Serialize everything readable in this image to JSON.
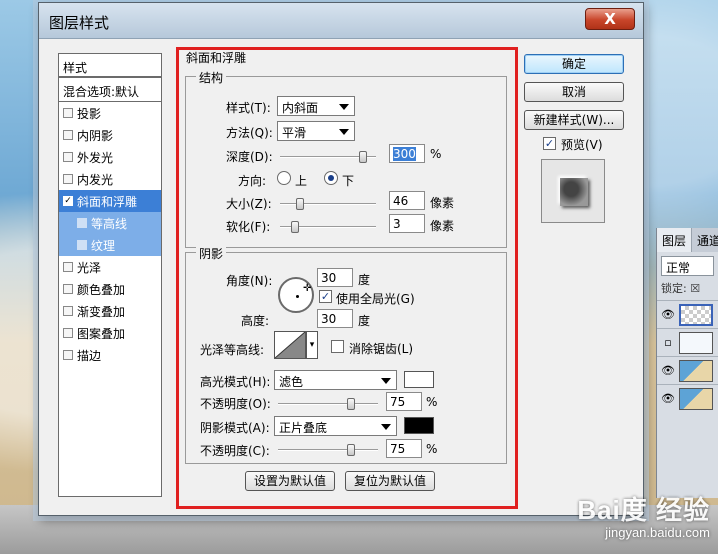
{
  "dialog": {
    "title": "图层样式",
    "close_label": "X"
  },
  "style_list": {
    "header": "样式",
    "blend": "混合选项:默认",
    "items": [
      {
        "label": "投影",
        "checked": false
      },
      {
        "label": "内阴影",
        "checked": false
      },
      {
        "label": "外发光",
        "checked": false
      },
      {
        "label": "内发光",
        "checked": false
      },
      {
        "label": "斜面和浮雕",
        "checked": true,
        "selected": true
      },
      {
        "label": "等高线",
        "checked": false,
        "sub": true
      },
      {
        "label": "纹理",
        "checked": false,
        "sub": true
      },
      {
        "label": "光泽",
        "checked": false
      },
      {
        "label": "颜色叠加",
        "checked": false
      },
      {
        "label": "渐变叠加",
        "checked": false
      },
      {
        "label": "图案叠加",
        "checked": false
      },
      {
        "label": "描边",
        "checked": false
      }
    ]
  },
  "bevel": {
    "section_title": "斜面和浮雕",
    "structure": {
      "title": "结构",
      "style_label": "样式(T):",
      "style_value": "内斜面",
      "technique_label": "方法(Q):",
      "technique_value": "平滑",
      "depth_label": "深度(D):",
      "depth_value": "300",
      "depth_unit": "%",
      "depth_level": 0.9,
      "direction_label": "方向:",
      "dir_up": "上",
      "dir_down": "下",
      "size_label": "大小(Z):",
      "size_value": "46",
      "size_unit": "像素",
      "size_level": 0.18,
      "soften_label": "软化(F):",
      "soften_value": "3",
      "soften_unit": "像素",
      "soften_level": 0.12
    },
    "shading": {
      "title": "阴影",
      "angle_label": "角度(N):",
      "angle_value": "30",
      "angle_unit": "度",
      "global_light_label": "使用全局光(G)",
      "altitude_label": "高度:",
      "altitude_value": "30",
      "altitude_unit": "度",
      "gloss_label": "光泽等高线:",
      "antialias_label": "消除锯齿(L)",
      "highlight_mode_label": "高光模式(H):",
      "highlight_mode_value": "滤色",
      "highlight_color": "#ffffff",
      "highlight_opacity_label": "不透明度(O):",
      "highlight_opacity_value": "75",
      "highlight_opacity_unit": "%",
      "highlight_opacity_level": 0.75,
      "shadow_mode_label": "阴影模式(A):",
      "shadow_mode_value": "正片叠底",
      "shadow_color": "#000000",
      "shadow_opacity_label": "不透明度(C):",
      "shadow_opacity_value": "75",
      "shadow_opacity_unit": "%",
      "shadow_opacity_level": 0.75
    },
    "make_default": "设置为默认值",
    "reset_default": "复位为默认值"
  },
  "actions": {
    "ok": "确定",
    "cancel": "取消",
    "new_style": "新建样式(W)...",
    "preview_label": "预览(V)"
  },
  "layers_panel": {
    "tab_layers": "图层",
    "tab_channels": "通道",
    "blend_mode": "正常",
    "lock_label": "锁定:"
  },
  "watermark": {
    "logo": "Bai度 经验",
    "url": "jingyan.baidu.com"
  }
}
